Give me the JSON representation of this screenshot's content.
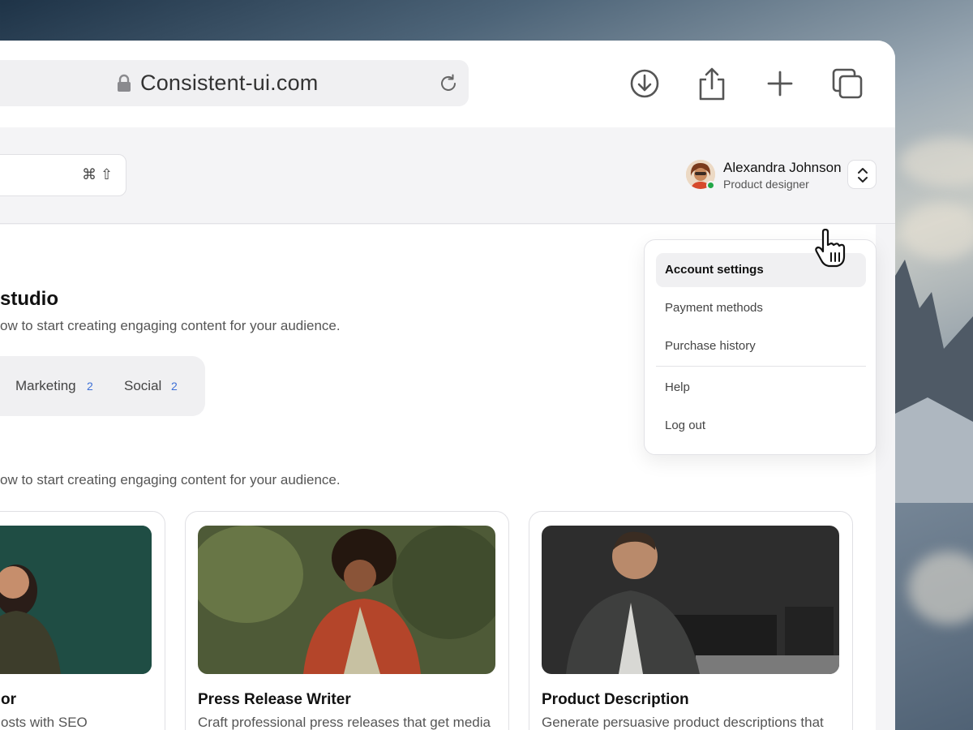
{
  "browser": {
    "url": "Consistent-ui.com",
    "toolbar_icons": [
      "download-icon",
      "share-icon",
      "new-tab-icon",
      "tabs-overview-icon"
    ]
  },
  "search": {
    "shortcut_modifier": "⌘",
    "shortcut_key": "⇧"
  },
  "user": {
    "name": "Alexandra Johnson",
    "role": "Product designer",
    "status_color": "#22a748"
  },
  "user_menu": {
    "items": [
      {
        "label": "Account settings",
        "active": true
      },
      {
        "label": "Payment methods"
      },
      {
        "label": "Purchase history"
      },
      {
        "label": "Help"
      },
      {
        "label": "Log out"
      }
    ]
  },
  "main": {
    "title": "studio",
    "subtitle": "ow to start creating engaging content for your audience.",
    "tabs": [
      {
        "label": "Marketing",
        "count": "2"
      },
      {
        "label": "Social",
        "count": "2"
      }
    ],
    "section_subtitle": "ow to start creating engaging content for your audience.",
    "cards": [
      {
        "title": "or",
        "description": "osts with SEO"
      },
      {
        "title": "Press Release Writer",
        "description": "Craft professional press releases that get media"
      },
      {
        "title": "Product Description",
        "description": "Generate persuasive product descriptions that"
      }
    ]
  },
  "colors": {
    "accent": "#3d6fd6",
    "surface": "#f4f4f6"
  }
}
